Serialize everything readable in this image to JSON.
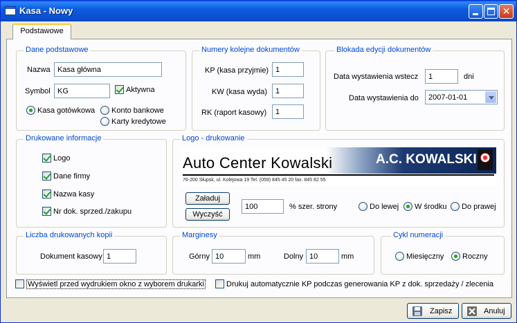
{
  "window": {
    "title": "Kasa - Nowy"
  },
  "tabs": [
    {
      "label": "Podstawowe"
    }
  ],
  "basic": {
    "legend": "Dane podstawowe",
    "name_label": "Nazwa",
    "name_value": "Kasa główna",
    "symbol_label": "Symbol",
    "symbol_value": "KG",
    "active_label": "Aktywna",
    "active_checked": true,
    "type_cash": "Kasa gotówkowa",
    "type_bank": "Konto bankowe",
    "type_cards": "Karty kredytowe",
    "selected_type": "Kasa gotówkowa"
  },
  "numbers": {
    "legend": "Numery kolejne dokumentów",
    "kp_label": "KP (kasa przyjmie)",
    "kp_value": "1",
    "kw_label": "KW (kasa wyda)",
    "kw_value": "1",
    "rk_label": "RK (raport kasowy)",
    "rk_value": "1"
  },
  "lock": {
    "legend": "Blokada edycji dokumentów",
    "days_back_label": "Data wystawienia wstecz",
    "days_back_value": "1",
    "days_unit": "dni",
    "date_to_label": "Data wystawienia do",
    "date_to_value": "2007-01-01"
  },
  "printed": {
    "legend": "Drukowane informacje",
    "items": [
      {
        "label": "Logo",
        "checked": true
      },
      {
        "label": "Dane firmy",
        "checked": true
      },
      {
        "label": "Nazwa kasy",
        "checked": true
      },
      {
        "label": "Nr dok. sprzed./zakupu",
        "checked": true
      }
    ]
  },
  "logo": {
    "legend": "Logo - drukowanie",
    "image_main_text": "Auto Center Kowalski",
    "image_brand_text": "A.C. KOWALSKI",
    "image_address_text": "76-200 Słupsk, ul. Kolejowa 19    Tel. (059) 845 45 20  fax. 845 82 55",
    "load_button": "Załaduj",
    "clear_button": "Wyczyść",
    "width_value": "100",
    "width_label": "% szer. strony",
    "align_left": "Do lewej",
    "align_center": "W środku",
    "align_right": "Do prawej",
    "selected_align": "W środku"
  },
  "copies": {
    "legend": "Liczba drukowanych kopii",
    "doc_label": "Dokument kasowy",
    "doc_value": "1"
  },
  "margins": {
    "legend": "Marginesy",
    "top_label": "Górny",
    "top_value": "10",
    "bottom_label": "Dolny",
    "bottom_value": "10",
    "unit": "mm"
  },
  "cycle": {
    "legend": "Cykl numeracji",
    "monthly": "Miesięczny",
    "yearly": "Roczny",
    "selected": "Roczny"
  },
  "options": {
    "show_printer_dialog": "Wyświetl przed wydrukiem okno z wyborem drukarki",
    "auto_print_kp": "Drukuj automatycznie KP podczas generowania KP z dok. sprzedaży / zlecenia"
  },
  "footer": {
    "save_button": "Zapisz",
    "cancel_button": "Anuluj"
  },
  "icons": {
    "app": "window-icon",
    "save": "floppy-disk-icon",
    "cancel": "close-x-icon"
  }
}
